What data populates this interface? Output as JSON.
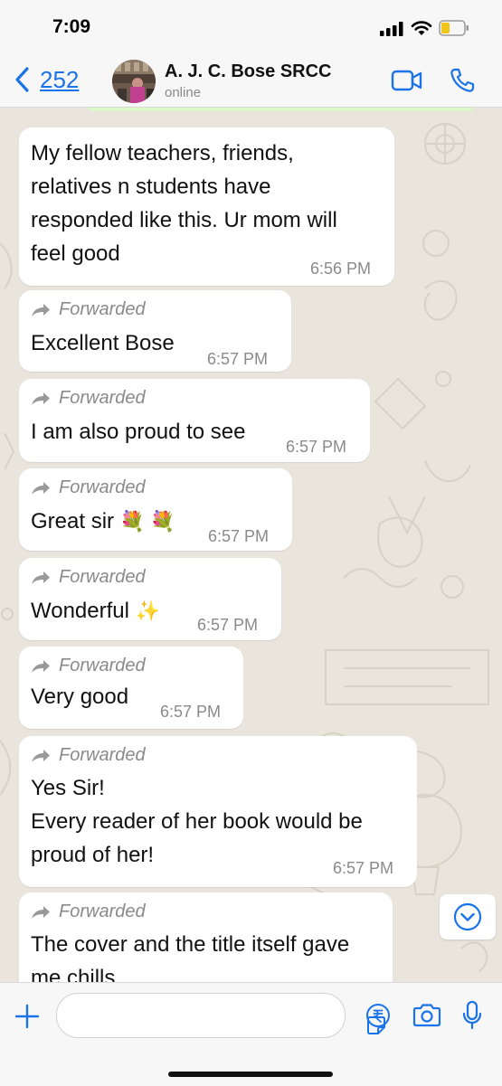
{
  "status_bar": {
    "time": "7:09"
  },
  "header": {
    "back_count": "252",
    "contact_name": "A. J. C. Bose SRCC",
    "contact_status": "online"
  },
  "forwarded_label": "Forwarded",
  "messages": [
    {
      "lines": [
        "My fellow teachers, friends,",
        "relatives n students have",
        "responded like this. Ur mom will",
        "feel good"
      ],
      "time": "6:56 PM",
      "forwarded": false
    },
    {
      "lines": [
        "Excellent Bose"
      ],
      "time": "6:57 PM",
      "forwarded": true
    },
    {
      "lines": [
        "I am also proud to see"
      ],
      "time": "6:57 PM",
      "forwarded": true
    },
    {
      "lines": [
        "Great sir"
      ],
      "emoji": "💐 💐",
      "time": "6:57 PM",
      "forwarded": true
    },
    {
      "lines": [
        "Wonderful"
      ],
      "emoji": "✨",
      "time": "6:57 PM",
      "forwarded": true
    },
    {
      "lines": [
        "Very good"
      ],
      "time": "6:57 PM",
      "forwarded": true
    },
    {
      "lines": [
        "Yes Sir!",
        "Every reader of her book would be",
        "proud of her!"
      ],
      "time": "6:57 PM",
      "forwarded": true
    },
    {
      "lines": [
        "The cover and the title itself gave",
        "me chills"
      ],
      "forwarded": true
    }
  ],
  "colors": {
    "accent": "#1a73e8",
    "chat_background": "#e9e4dc",
    "bubble": "#ffffff",
    "outgoing_bubble": "#dcf8c6"
  },
  "icons": {
    "back": "chevron-left-icon",
    "video": "video-camera-icon",
    "phone": "phone-icon",
    "forward": "forward-arrow-icon",
    "scroll_down": "chevron-down-circle-icon",
    "plus": "plus-icon",
    "sticker": "sticker-icon",
    "payment": "rupee-icon",
    "camera": "camera-icon",
    "mic": "microphone-icon"
  }
}
